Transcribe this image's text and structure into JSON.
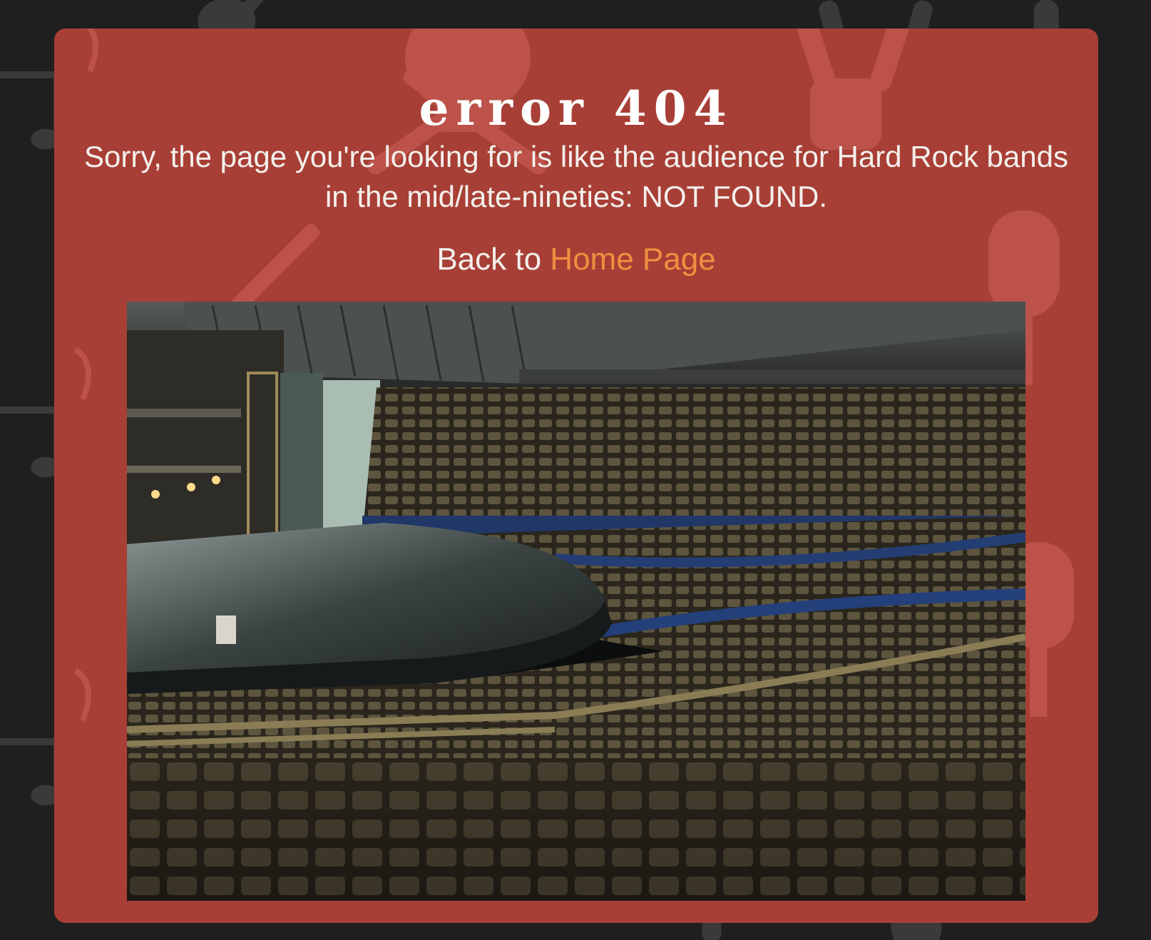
{
  "error": {
    "title": "error 404",
    "message": "Sorry, the page you're looking for is like the audience for Hard Rock bands in the mid/late-nineties: NOT FOUND.",
    "back_prefix": "Back to ",
    "home_link_label": "Home Page"
  },
  "colors": {
    "page_background": "#1f1f1f",
    "card_background": "#a83f36",
    "link": "#f0903f",
    "text": "#f3f0ec"
  },
  "icons": [
    "guitar-icon",
    "skull-icon",
    "rock-hand-icon",
    "microphone-icon",
    "music-note-icon"
  ]
}
